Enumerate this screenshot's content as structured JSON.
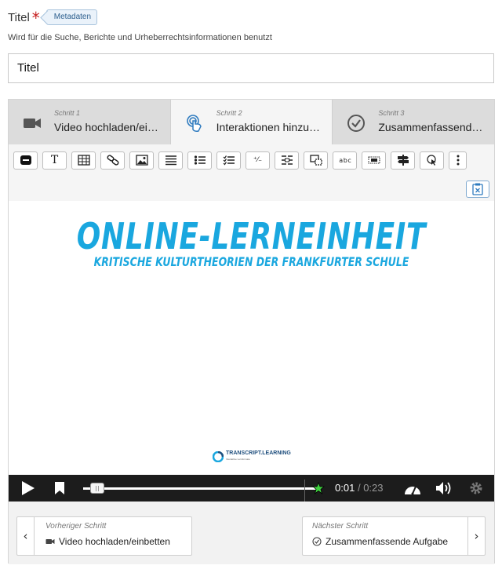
{
  "field": {
    "label": "Titel",
    "required_mark": "*",
    "meta_tag": "Metadaten",
    "description": "Wird für die Suche, Berichte und Urheberrechtsinformationen benutzt",
    "value": "Titel"
  },
  "steps": [
    {
      "small": "Schritt 1",
      "title": "Video hochladen/einbetten",
      "icon": "video-camera-icon"
    },
    {
      "small": "Schritt 2",
      "title": "Interaktionen hinzufügen",
      "icon": "touch-icon"
    },
    {
      "small": "Schritt 3",
      "title": "Zusammenfassende Aufgabe",
      "icon": "check-circle-icon"
    }
  ],
  "toolbar": {
    "buttons": [
      "label-icon",
      "text-icon",
      "table-icon",
      "link-icon",
      "image-icon",
      "statements-icon",
      "single-choice-icon",
      "multiple-choice-icon",
      "fill-blanks-icon",
      "drag-text-icon",
      "drag-drop-icon",
      "mark-words-icon",
      "drag-text-advanced-icon",
      "crossroads-icon",
      "navigation-hotspot-icon",
      "more-icon"
    ],
    "text_tool": "T",
    "fraction_tool": "⁺⁄₋",
    "mark_tool": "a b c",
    "paste_icon": "paste-icon"
  },
  "video": {
    "title": "ONLINE-LERNEINHEIT",
    "subtitle": "KRITISCHE KULTURTHEORIEN DER FRANKFURTER SCHULE",
    "logo": "TRANSCRIPT.LEARNING",
    "logo_sub": "Interaktive Lernformate"
  },
  "player": {
    "current": "0:01",
    "separator": "/",
    "total": "0:23",
    "progress": 0.04
  },
  "nav": {
    "prev_small": "Vorheriger Schritt",
    "prev_label": "Video hochladen/einbetten",
    "next_small": "Nächster Schritt",
    "next_label": "Zusammenfassende Aufgabe"
  },
  "colors": {
    "accent": "#2f7bbf",
    "video_text": "#1aa7df",
    "required": "#c62020"
  }
}
